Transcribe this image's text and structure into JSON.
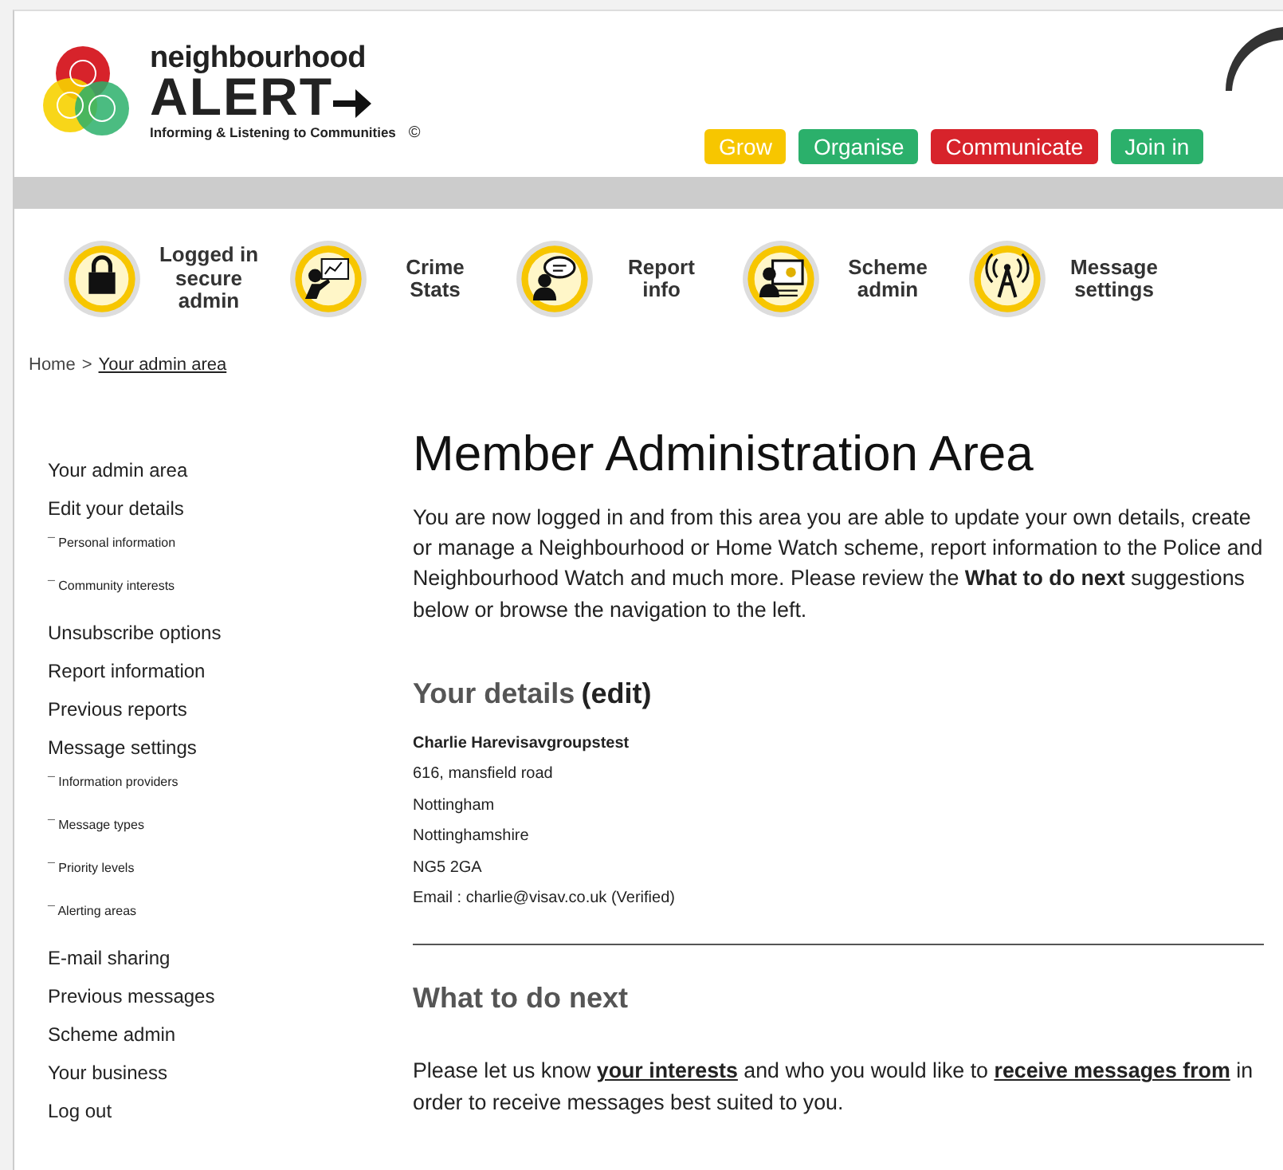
{
  "logo": {
    "top": "neighbourhood",
    "main": "ALERT",
    "tagline": "Informing & Listening to Communities",
    "copyright": "©"
  },
  "header_buttons": [
    {
      "label": "Grow",
      "color": "#f7c600"
    },
    {
      "label": "Organise",
      "color": "#2bb06b"
    },
    {
      "label": "Communicate",
      "color": "#d7232b"
    },
    {
      "label": "Join in",
      "color": "#2bb06b"
    }
  ],
  "quick_links": [
    {
      "kind": "lock",
      "label": "Logged in secure admin"
    },
    {
      "kind": "stats",
      "label": "Crime Stats"
    },
    {
      "kind": "report",
      "label": "Report info"
    },
    {
      "kind": "scheme",
      "label": "Scheme admin"
    },
    {
      "kind": "signal",
      "label": "Message settings"
    }
  ],
  "breadcrumb": [
    {
      "label": "Home",
      "link": false
    },
    {
      "label": ">",
      "link": false
    },
    {
      "label": "Your admin area",
      "link": true
    }
  ],
  "sidebar": {
    "items": [
      {
        "label": "Your admin area",
        "kind": "main"
      },
      {
        "label": "Edit your details",
        "kind": "main"
      },
      {
        "label": "¯ Personal information",
        "kind": "sub"
      },
      {
        "label": "¯ Community interests",
        "kind": "sub"
      },
      {
        "label": "Unsubscribe options",
        "kind": "main"
      },
      {
        "label": "Report information",
        "kind": "main"
      },
      {
        "label": "Previous reports",
        "kind": "main"
      },
      {
        "label": "Message settings",
        "kind": "main"
      },
      {
        "label": "¯ Information providers",
        "kind": "sub"
      },
      {
        "label": "¯ Message types",
        "kind": "sub"
      },
      {
        "label": "¯ Priority levels",
        "kind": "sub"
      },
      {
        "label": "¯ Alerting areas",
        "kind": "sub"
      },
      {
        "label": "E-mail sharing",
        "kind": "main"
      },
      {
        "label": "Previous messages",
        "kind": "main"
      },
      {
        "label": "Scheme admin",
        "kind": "main"
      },
      {
        "label": "Your business",
        "kind": "main"
      },
      {
        "label": "Log out",
        "kind": "main"
      }
    ]
  },
  "main": {
    "title": "Member Administration Area",
    "intro": "You are now logged in and from this area you are able to update your own details, create or manage a Neighbourhood or Home Watch scheme, report information to the Police and Neighbourhood Watch and much more. Please review the **What to do next** suggestions below or browse the navigation to the left.",
    "details_heading": "Your details",
    "details_edit": "(edit)",
    "details": [
      {
        "text": "Charlie Harevisavgroupstest",
        "kind": "name"
      },
      {
        "text": "616, mansfield road",
        "kind": "line"
      },
      {
        "text": "Nottingham",
        "kind": "line"
      },
      {
        "text": "Nottinghamshire",
        "kind": "line"
      },
      {
        "text": "NG5 2GA",
        "kind": "line"
      },
      {
        "text": "Email : charlie@visav.co.uk (Verified)",
        "kind": "email"
      }
    ],
    "next_heading": "What to do next",
    "next_text": [
      {
        "text": "Please let us know ",
        "link": false
      },
      {
        "text": "your interests",
        "link": true
      },
      {
        "text": " and who you would like to ",
        "link": false
      },
      {
        "text": "receive messages from",
        "link": true
      },
      {
        "text": " in order to receive messages best suited to you.",
        "link": false
      }
    ]
  }
}
